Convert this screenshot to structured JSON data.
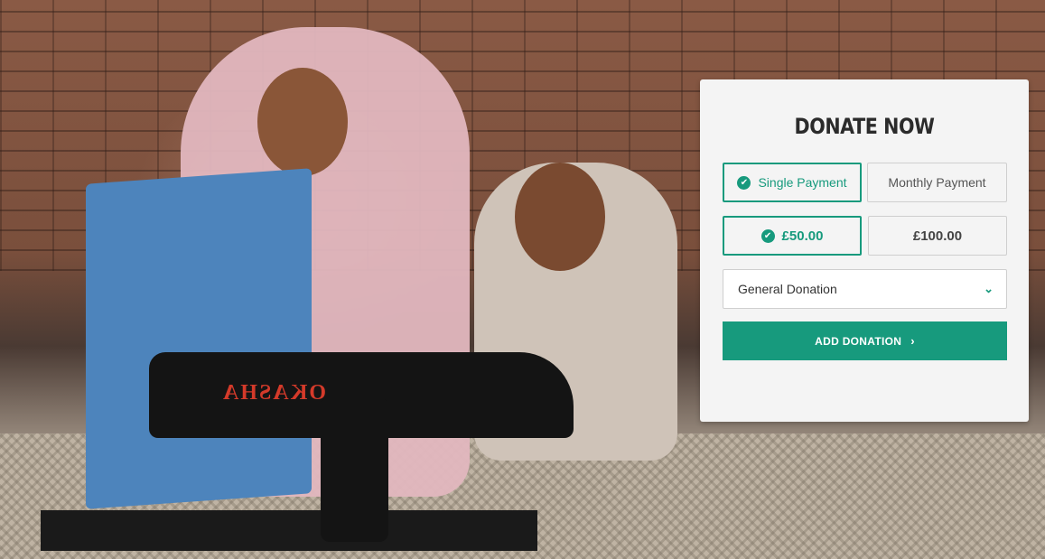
{
  "hero": {
    "machine_brand": "OKASHA"
  },
  "donate": {
    "title": "DONATE NOW",
    "payment_types": [
      {
        "label": "Single Payment",
        "selected": true
      },
      {
        "label": "Monthly Payment",
        "selected": false
      }
    ],
    "amounts": [
      {
        "label": "£50.00",
        "selected": true
      },
      {
        "label": "£100.00",
        "selected": false
      }
    ],
    "fund_select": {
      "value": "General Donation",
      "icon": "chevron-down-icon"
    },
    "add_button": {
      "label": "ADD DONATION",
      "icon": "chevron-right-icon"
    },
    "colors": {
      "accent": "#179a7d",
      "card_bg": "#f4f4f4",
      "title": "#2b2b2b"
    }
  }
}
